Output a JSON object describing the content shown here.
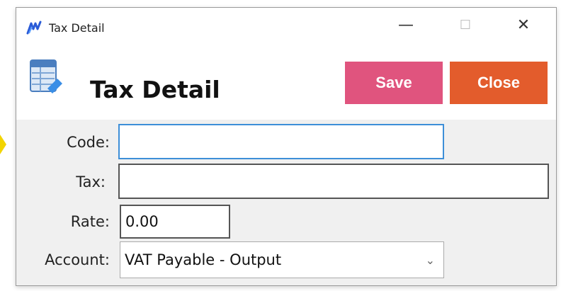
{
  "window": {
    "title": "Tax Detail",
    "minimize_glyph": "—",
    "maximize_glyph": "☐",
    "close_glyph": "✕"
  },
  "header": {
    "title": "Tax Detail",
    "icon": "table-edit-icon"
  },
  "buttons": {
    "save_label": "Save",
    "close_label": "Close",
    "save_color": "#e0547e",
    "close_color": "#e35c2c"
  },
  "form": {
    "code_label": "Code:",
    "code_value": "",
    "tax_label": "Tax:",
    "tax_value": "",
    "rate_label": "Rate:",
    "rate_value": "0.00",
    "account_label": "Account:",
    "account_value": "VAT Payable - Output"
  }
}
